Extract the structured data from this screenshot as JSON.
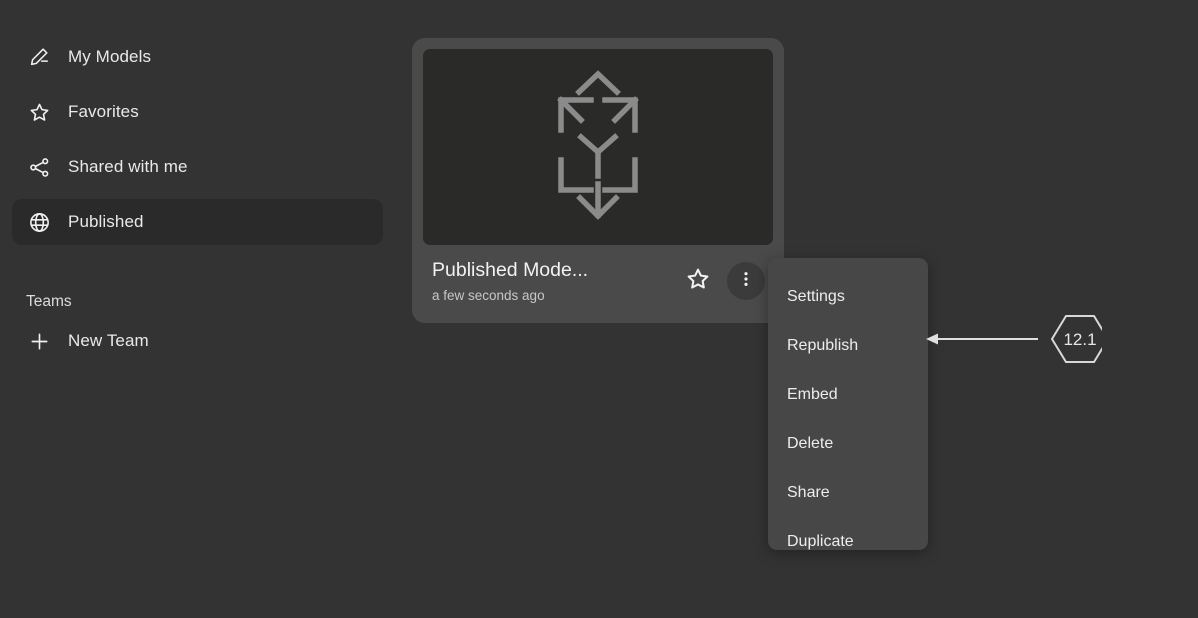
{
  "sidebar": {
    "items": [
      {
        "label": "My Models",
        "icon": "pencil-icon",
        "active": false
      },
      {
        "label": "Favorites",
        "icon": "star-icon",
        "active": false
      },
      {
        "label": "Shared with me",
        "icon": "share-icon",
        "active": false
      },
      {
        "label": "Published",
        "icon": "globe-icon",
        "active": true
      }
    ],
    "teams_heading": "Teams",
    "new_team_label": "New Team",
    "new_team_icon": "plus-icon",
    "active_bg": "#2a2a2a"
  },
  "card": {
    "title": "Published Mode...",
    "subtitle": "a few seconds ago",
    "thumbnail_icon": "cube-3d-placeholder-icon",
    "favorite_icon": "star-outline-icon",
    "menu_icon": "kebab-menu-icon",
    "bg": "#4a4a4a",
    "thumb_bg": "#2a2a28"
  },
  "context_menu": {
    "items": [
      {
        "label": "Settings"
      },
      {
        "label": "Republish"
      },
      {
        "label": "Embed"
      },
      {
        "label": "Delete"
      },
      {
        "label": "Share"
      },
      {
        "label": "Duplicate"
      }
    ],
    "bg": "#474747"
  },
  "annotation": {
    "badge_text": "12.1",
    "shape": "hexagon",
    "stroke": "#e0e0e0",
    "points_to": "Republish"
  },
  "theme": {
    "page_bg": "#333333",
    "text": "#e9e9e9",
    "muted_text": "#c7c7c7"
  }
}
